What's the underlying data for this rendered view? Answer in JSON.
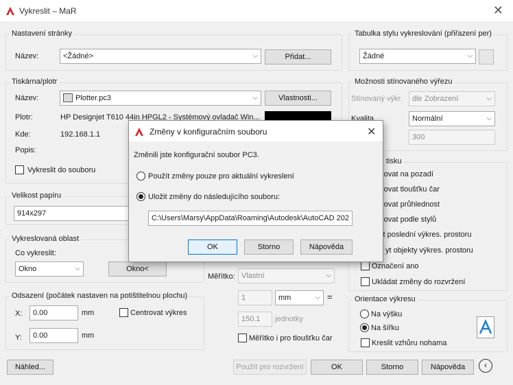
{
  "window": {
    "title": "Vykreslit – MaR"
  },
  "page_setup": {
    "group_title": "Nastavení stránky",
    "name_label": "Název:",
    "name_value": "<Žádné>",
    "add_button": "Přidat..."
  },
  "printer": {
    "group_title": "Tiskárna/plotr",
    "name_label": "Název:",
    "name_value": "Plotter.pc3",
    "properties_button": "Vlastnosti...",
    "plotter_label": "Plotr:",
    "plotter_value": "HP Designjet T610 44in HPGL2 - Systémový ovladač Win...",
    "where_label": "Kde:",
    "where_value": "192.168.1.1",
    "desc_label": "Popis:",
    "plot_to_file": "Vykreslit do souboru"
  },
  "paper_size": {
    "group_title": "Velikost papíru",
    "value": "914x297"
  },
  "plot_area": {
    "group_title": "Vykreslovaná oblast",
    "what_label": "Co vykreslit:",
    "what_value": "Okno",
    "window_button": "Okno<"
  },
  "offset": {
    "group_title": "Odsazení (počátek nastaven na potištitelnou plochu)",
    "x_label": "X:",
    "x_value": "0.00",
    "x_unit": "mm",
    "y_label": "Y:",
    "y_value": "0.00",
    "y_unit": "mm",
    "center_label": "Centrovat výkres"
  },
  "scale": {
    "scale_label": "Měřítko:",
    "scale_value": "Vlastní",
    "value1": "1",
    "unit1": "mm",
    "eq": "=",
    "value2": "150.1",
    "unit2": "jednotky",
    "lineweights": "Měřítko i pro tloušťku čar"
  },
  "style_table": {
    "group_title": "Tabulka stylu vykreslování (přiřazení per)",
    "value": "Žádné"
  },
  "shaded": {
    "group_title": "Možnosti stínovaného výřezu",
    "shade_label": "Stínovaný výkr.",
    "shade_value": "dle Zobrazení",
    "quality_label": "Kvalita",
    "quality_value": "Normální",
    "dpi_value": "300"
  },
  "options": {
    "group_title": "tisku",
    "items": [
      "reslovat na pozadí",
      "reslovat tloušťku čar",
      "reslovat průhlednost",
      "reslovat podle stylů",
      "eslit poslední výkres. prostoru",
      "yt objekty výkres. prostoru",
      "Označení ano",
      "Ukládat změny do rozvržení"
    ]
  },
  "orientation": {
    "group_title": "Orientace výkresu",
    "portrait": "Na výšku",
    "landscape": "Na šířku",
    "upside": "Kreslit vzhůru nohama"
  },
  "bottom": {
    "preview": "Náhled...",
    "apply": "Použít pro rozvržení",
    "ok": "OK",
    "cancel": "Storno",
    "help": "Nápověda"
  },
  "modal": {
    "title": "Změny v konfiguračním souboru",
    "message": "Změnili jste konfigurační soubor PC3.",
    "option1": "Použít změny pouze pro aktuální vykreslení",
    "option2": "Uložit změny do následujícího souboru:",
    "path": "C:\\Users\\Marsy\\AppData\\Roaming\\Autodesk\\AutoCAD 202",
    "ok": "OK",
    "cancel": "Storno",
    "help": "Nápověda"
  },
  "colors": {
    "accent": "#0078d7",
    "acad_red": "#d9252b"
  }
}
